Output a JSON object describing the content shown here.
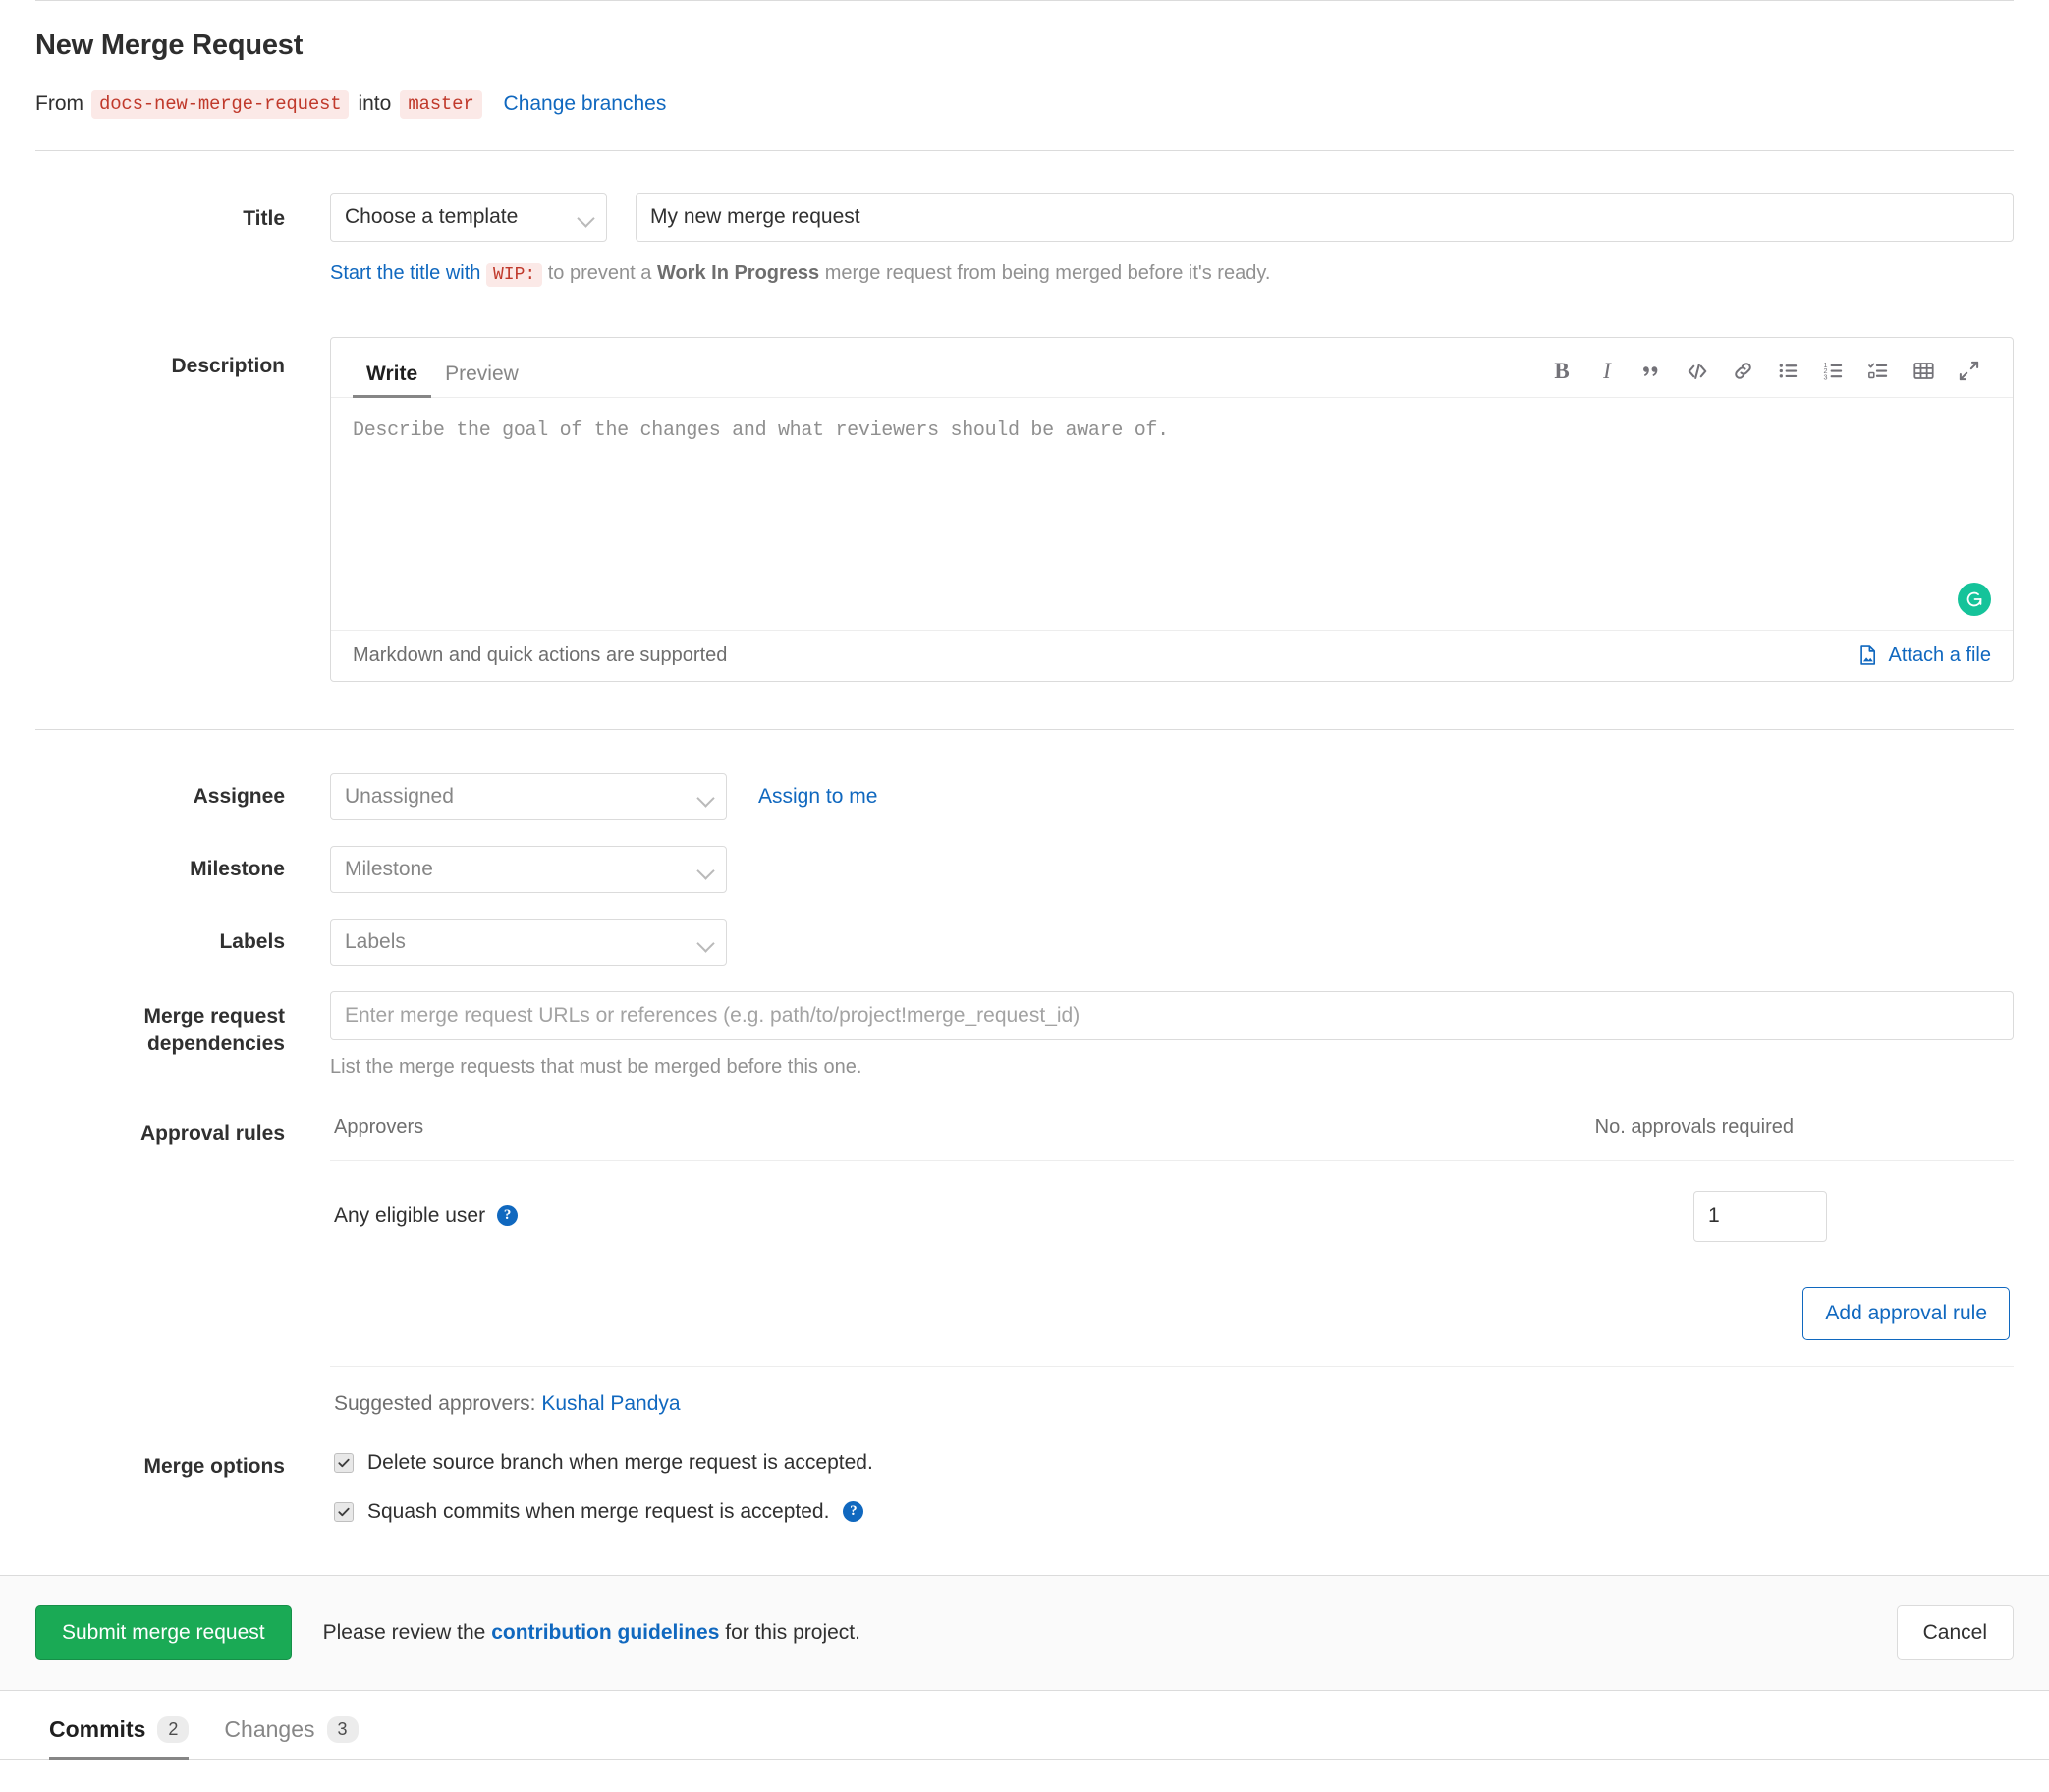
{
  "header": {
    "title": "New Merge Request",
    "from_word": "From",
    "source_branch": "docs-new-merge-request",
    "into_word": "into",
    "target_branch": "master",
    "change_branches": "Change branches"
  },
  "title_section": {
    "label": "Title",
    "template_select": "Choose a template",
    "title_value": "My new merge request",
    "hint_link": "Start the title with",
    "hint_code": "WIP:",
    "hint_mid": "to prevent a",
    "hint_bold": "Work In Progress",
    "hint_tail": "merge request from being merged before it's ready."
  },
  "description": {
    "label": "Description",
    "tabs": [
      {
        "label": "Write",
        "active": true
      },
      {
        "label": "Preview",
        "active": false
      }
    ],
    "toolbar": [
      "bold-icon",
      "italic-icon",
      "quote-icon",
      "code-icon",
      "link-icon",
      "bullet-list-icon",
      "numbered-list-icon",
      "task-list-icon",
      "table-icon",
      "fullscreen-icon"
    ],
    "placeholder": "Describe the goal of the changes and what reviewers should be aware of.",
    "grammarly_icon": "grammarly-icon",
    "footer_markdown": "Markdown",
    "footer_and": "and",
    "footer_quick_actions": "quick actions",
    "footer_supported": "are supported",
    "attach_label": "Attach a file",
    "attach_icon": "attach-file-icon"
  },
  "meta": {
    "assignee": {
      "label": "Assignee",
      "value": "Unassigned",
      "action": "Assign to me"
    },
    "milestone": {
      "label": "Milestone",
      "value": "Milestone"
    },
    "labels": {
      "label": "Labels",
      "value": "Labels"
    },
    "dependencies": {
      "label_line1": "Merge request",
      "label_line2": "dependencies",
      "placeholder": "Enter merge request URLs or references (e.g. path/to/project!merge_request_id)",
      "value": "",
      "help": "List the merge requests that must be merged before this one."
    },
    "approval_rules": {
      "label": "Approval rules",
      "col_approvers": "Approvers",
      "col_required": "No. approvals required",
      "rows": [
        {
          "approver": "Any eligible user",
          "help_icon": "question-icon",
          "count": "1"
        }
      ],
      "add_button": "Add approval rule",
      "suggested_label": "Suggested approvers:",
      "suggested_name": "Kushal Pandya"
    },
    "merge_options": {
      "label": "Merge options",
      "items": [
        {
          "text": "Delete source branch when merge request is accepted.",
          "checked": true,
          "help": false
        },
        {
          "text": "Squash commits when merge request is accepted.",
          "checked": true,
          "help": true
        }
      ]
    }
  },
  "footer": {
    "submit_label": "Submit merge request",
    "note_pre": "Please review the",
    "note_link": "contribution guidelines",
    "note_post": "for this project.",
    "cancel_label": "Cancel"
  },
  "bottom_tabs": [
    {
      "label": "Commits",
      "badge": "2",
      "active": true
    },
    {
      "label": "Changes",
      "badge": "3",
      "active": false
    }
  ],
  "colors": {
    "link": "#1068bf",
    "success": "#1aaa55",
    "code_bg": "#fbe9e7",
    "code_fg": "#c0392b",
    "grammarly": "#15c39a"
  }
}
